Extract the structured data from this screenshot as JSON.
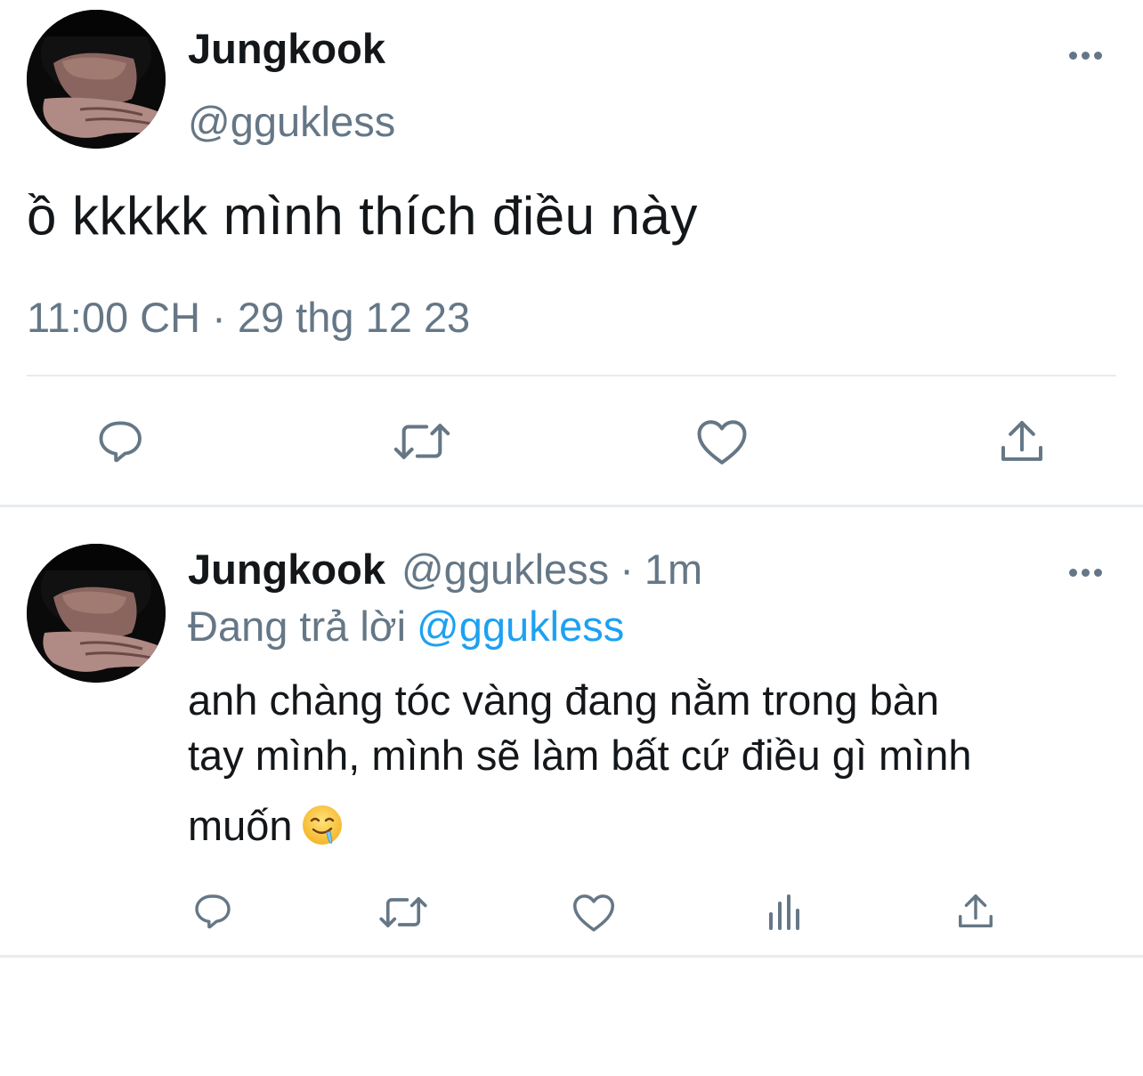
{
  "main_tweet": {
    "author_name": "Jungkook",
    "author_handle": "@ggukless",
    "text": "ồ kkkkk mình thích điều này",
    "timestamp": "11:00 CH · 29 thg 12 23",
    "actions": [
      {
        "name": "reply",
        "icon": "speech-bubble-icon"
      },
      {
        "name": "retweet",
        "icon": "retweet-icon"
      },
      {
        "name": "like",
        "icon": "heart-icon"
      },
      {
        "name": "share",
        "icon": "share-icon"
      }
    ]
  },
  "reply_tweet": {
    "author_name": "Jungkook",
    "author_handle": "@ggukless",
    "separator": "·",
    "time": "1m",
    "replying_label": "Đang trả lời",
    "replying_to": "@ggukless",
    "text_lines": [
      "anh chàng tóc vàng đang nằm trong bàn",
      "tay mình, mình sẽ làm bất cứ điều gì mình",
      "muốn"
    ],
    "emoji": "drooling-face",
    "actions": [
      {
        "name": "reply",
        "icon": "speech-bubble-icon"
      },
      {
        "name": "retweet",
        "icon": "retweet-icon"
      },
      {
        "name": "like",
        "icon": "heart-icon"
      },
      {
        "name": "analytics",
        "icon": "bar-chart-icon"
      },
      {
        "name": "share",
        "icon": "share-icon"
      }
    ]
  },
  "colors": {
    "text_primary": "#14171a",
    "text_secondary": "#657786",
    "accent": "#1da1f2",
    "divider": "#e6ecf0"
  }
}
